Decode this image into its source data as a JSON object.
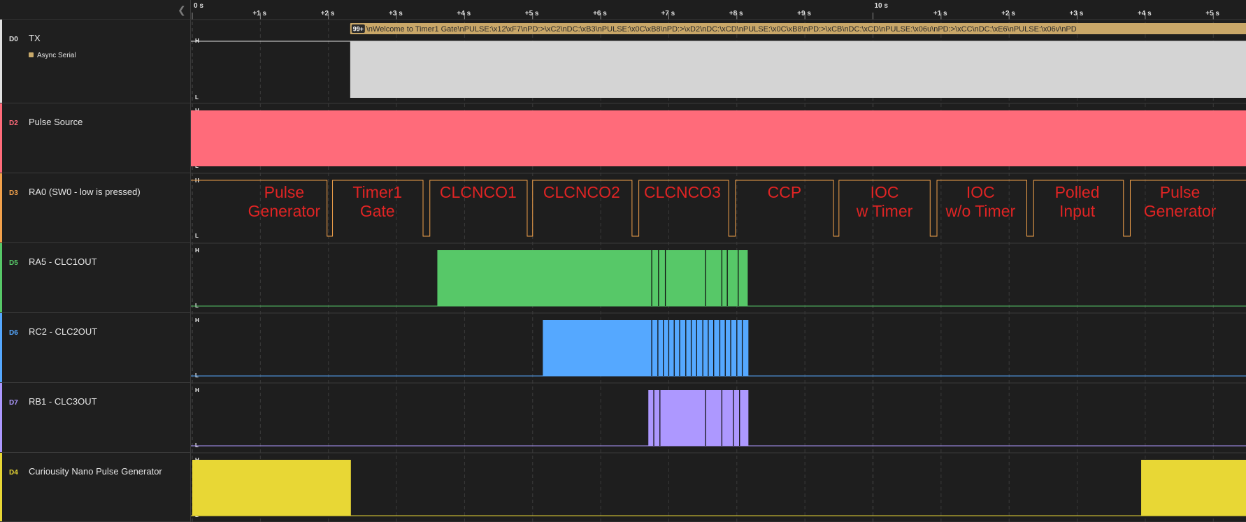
{
  "timeline": {
    "ticks": [
      {
        "t": 0,
        "label": "0 s",
        "major": true
      },
      {
        "t": 1,
        "label": "+1 s"
      },
      {
        "t": 2,
        "label": "+2 s"
      },
      {
        "t": 3,
        "label": "+3 s"
      },
      {
        "t": 4,
        "label": "+4 s"
      },
      {
        "t": 5,
        "label": "+5 s"
      },
      {
        "t": 6,
        "label": "+6 s"
      },
      {
        "t": 7,
        "label": "+7 s"
      },
      {
        "t": 8,
        "label": "+8 s"
      },
      {
        "t": 9,
        "label": "+9 s"
      },
      {
        "t": 10,
        "label": "10 s",
        "major": true
      },
      {
        "t": 11,
        "label": "+1 s"
      },
      {
        "t": 12,
        "label": "+2 s"
      },
      {
        "t": 13,
        "label": "+3 s"
      },
      {
        "t": 14,
        "label": "+4 s"
      },
      {
        "t": 15,
        "label": "+5 s"
      }
    ],
    "high_label": "H",
    "low_label": "L"
  },
  "channels": [
    {
      "id": "D0",
      "name": "TX",
      "color": "#e0e0e0",
      "kind": "tx",
      "analyzer": "Async Serial",
      "busy": [
        2.32,
        16.3
      ],
      "decoded_count": "99+",
      "decoded_text": "\\nWelcome to Timer1 Gate\\nPULSE:\\x12\\xF7\\nPD:>\\xC2\\nDC:\\xB3\\nPULSE:\\x0C\\xB8\\nPD:>\\xD2\\nDC:\\xCD\\nPULSE:\\x0C\\xB8\\nPD:>\\xCB\\nDC:\\xCD\\nPULSE:\\x06u\\nPD:>\\xCC\\nDC:\\xE6\\nPULSE:\\x06v\\nPD"
    },
    {
      "id": "D2",
      "name": "Pulse Source",
      "color": "#ff6b7a",
      "kind": "full"
    },
    {
      "id": "D3",
      "name": "RA0 (SW0 - low is pressed)",
      "color": "#f2a14b",
      "kind": "button",
      "low_pulses": [
        [
          1.98,
          2.06
        ],
        [
          3.39,
          3.49
        ],
        [
          4.92,
          5.0
        ],
        [
          6.46,
          6.56
        ],
        [
          7.88,
          7.98
        ],
        [
          9.42,
          9.5
        ],
        [
          10.84,
          10.94
        ],
        [
          12.26,
          12.36
        ],
        [
          13.68,
          13.78
        ]
      ],
      "labels": [
        {
          "lines": [
            "Pulse",
            "Generator"
          ],
          "t": 1.35
        },
        {
          "lines": [
            "Timer1",
            "Gate"
          ],
          "t": 2.72
        },
        {
          "lines": [
            "CLCNCO1"
          ],
          "t": 4.2
        },
        {
          "lines": [
            "CLCNCO2"
          ],
          "t": 5.72
        },
        {
          "lines": [
            "CLCNCO3"
          ],
          "t": 7.2
        },
        {
          "lines": [
            "CCP"
          ],
          "t": 8.7
        },
        {
          "lines": [
            "IOC",
            "w Timer"
          ],
          "t": 10.17
        },
        {
          "lines": [
            "IOC",
            "w/o Timer"
          ],
          "t": 11.58
        },
        {
          "lines": [
            "Polled",
            "Input"
          ],
          "t": 13.0
        },
        {
          "lines": [
            "Pulse",
            "Generator"
          ],
          "t": 14.51
        }
      ]
    },
    {
      "id": "D5",
      "name": "RA5 - CLC1OUT",
      "color": "#57c868",
      "kind": "burst",
      "active": [
        3.6,
        8.16
      ],
      "gaps": [
        6.75,
        6.85,
        6.95,
        7.54,
        7.78,
        7.86,
        8.02
      ]
    },
    {
      "id": "D6",
      "name": "RC2 - CLC2OUT",
      "color": "#55a8ff",
      "kind": "burst",
      "active": [
        5.15,
        8.17
      ],
      "gaps": [
        6.75,
        6.84,
        6.92,
        7.0,
        7.08,
        7.16,
        7.25,
        7.33,
        7.41,
        7.5,
        7.58,
        7.66,
        7.75,
        7.83,
        7.91,
        8.0,
        8.08
      ]
    },
    {
      "id": "D7",
      "name": "RB1 - CLC3OUT",
      "color": "#ad98ff",
      "kind": "burst",
      "active": [
        6.7,
        8.17
      ],
      "gaps": [
        6.78,
        6.87,
        7.54,
        7.78,
        7.95,
        8.04
      ]
    },
    {
      "id": "D4",
      "name": "Curiousity Nano Pulse Generator",
      "color": "#e8d735",
      "kind": "edges",
      "high": [
        [
          0.0,
          2.33
        ],
        [
          13.94,
          15.6
        ]
      ]
    }
  ]
}
